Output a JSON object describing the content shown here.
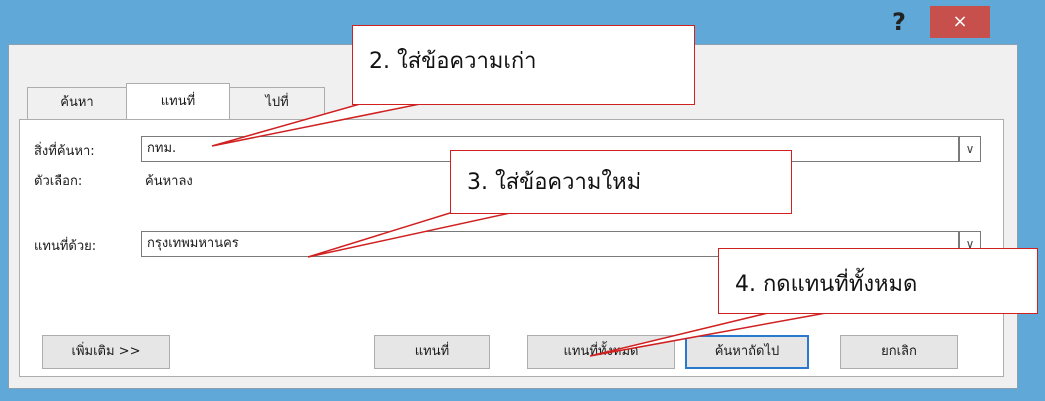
{
  "window": {
    "help_label": "?",
    "close_label": "×"
  },
  "tabs": [
    {
      "label": "ค้นหา"
    },
    {
      "label": "แทนที่"
    },
    {
      "label": "ไปที่"
    }
  ],
  "find": {
    "label": "สิ่งที่ค้นหา:",
    "value": "กทม."
  },
  "options": {
    "label": "ตัวเลือก:",
    "value": "ค้นหาลง"
  },
  "replace": {
    "label": "แทนที่ด้วย:",
    "value": "กรุงเทพมหานคร"
  },
  "buttons": {
    "more": "เพิ่มเติม >>",
    "replace": "แทนที่",
    "replace_all": "แทนที่ทั้งหมด",
    "find_next": "ค้นหาถัดไป",
    "cancel": "ยกเลิก"
  },
  "callouts": {
    "step2": "2. ใส่ข้อความเก่า",
    "step3": "3. ใส่ข้อความใหม่",
    "step4": "4. กดแทนที่ทั้งหมด"
  },
  "colors": {
    "frame": "#5fa8d8",
    "close": "#c7504c",
    "callout_border": "#d02020"
  }
}
